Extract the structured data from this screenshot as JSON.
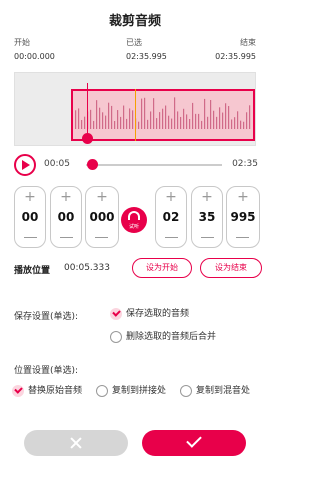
{
  "header": {
    "title": "裁剪音频"
  },
  "time_labels": {
    "start": {
      "label": "开始",
      "value": "00:00.000"
    },
    "selected": {
      "label": "已选",
      "value": "02:35.995"
    },
    "end": {
      "label": "结束",
      "value": "02:35.995"
    }
  },
  "player": {
    "current_time": "00:05",
    "total_time": "02:35",
    "progress_fraction": 0.035
  },
  "steppers": {
    "start": [
      "00",
      "00",
      "000"
    ],
    "end": [
      "02",
      "35",
      "995"
    ],
    "plus_symbol": "+"
  },
  "audition": {
    "label": "试听"
  },
  "position": {
    "label": "播放位置",
    "value": "00:05.333",
    "set_start_label": "设为开始",
    "set_end_label": "设为结束"
  },
  "save_settings": {
    "label": "保存设置(单选):",
    "options": [
      {
        "label": "保存选取的音频",
        "selected": true
      },
      {
        "label": "删除选取的音频后合并",
        "selected": false
      }
    ]
  },
  "location_settings": {
    "label": "位置设置(单选):",
    "options": [
      {
        "label": "替换原始音频",
        "selected": true
      },
      {
        "label": "复制到拼接处",
        "selected": false
      },
      {
        "label": "复制到混音处",
        "selected": false
      }
    ]
  },
  "colors": {
    "accent": "#e8004a",
    "cancel": "#d6d6d6",
    "playhead": "#f4a000"
  }
}
